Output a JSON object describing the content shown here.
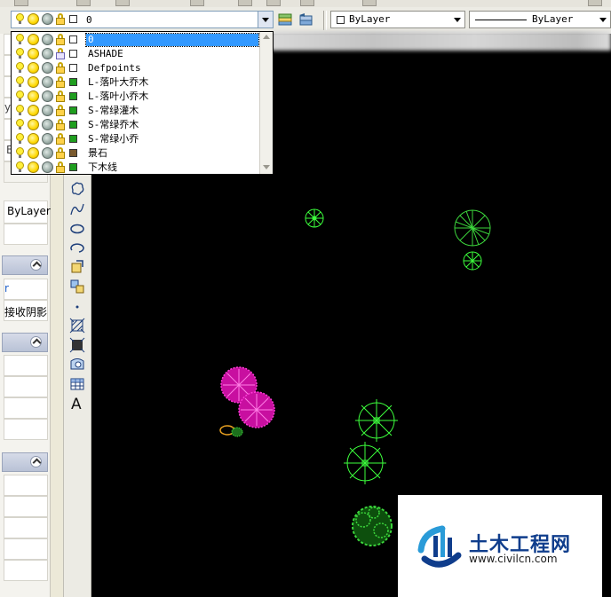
{
  "toolbar": {
    "current_layer": "0",
    "color_select": "ByLayer",
    "linetype_select": "ByLayer"
  },
  "layer_list": {
    "items": [
      {
        "name": "0",
        "color": "#ffffff",
        "selected": true,
        "plot": false
      },
      {
        "name": "ASHADE",
        "color": "#ffffff",
        "selected": false,
        "plot": true
      },
      {
        "name": "Defpoints",
        "color": "#ffffff",
        "selected": false,
        "plot": false
      },
      {
        "name": "L-落叶大乔木",
        "color": "#1f9e1f",
        "selected": false,
        "plot": false
      },
      {
        "name": "L-落叶小乔木",
        "color": "#1f9e1f",
        "selected": false,
        "plot": false
      },
      {
        "name": "S-常绿灌木",
        "color": "#1f9e1f",
        "selected": false,
        "plot": false
      },
      {
        "name": "S-常绿乔木",
        "color": "#1f9e1f",
        "selected": false,
        "plot": false
      },
      {
        "name": "S-常绿小乔",
        "color": "#1f9e1f",
        "selected": false,
        "plot": false
      },
      {
        "name": "景石",
        "color": "#7a5a2e",
        "selected": false,
        "plot": false
      },
      {
        "name": "下木线",
        "color": "#1f9e1f",
        "selected": false,
        "plot": false
      }
    ]
  },
  "properties_panel": {
    "fragment_1": "y",
    "fragment_2": "E",
    "linetype_value": "ByLayer",
    "fragment_3": "r",
    "shadow_value": "接收阴影"
  },
  "draw_toolbar": {
    "text_tool_label": "A"
  },
  "watermark": {
    "brand": "土木工程网",
    "url": "www.civilcn.com"
  }
}
